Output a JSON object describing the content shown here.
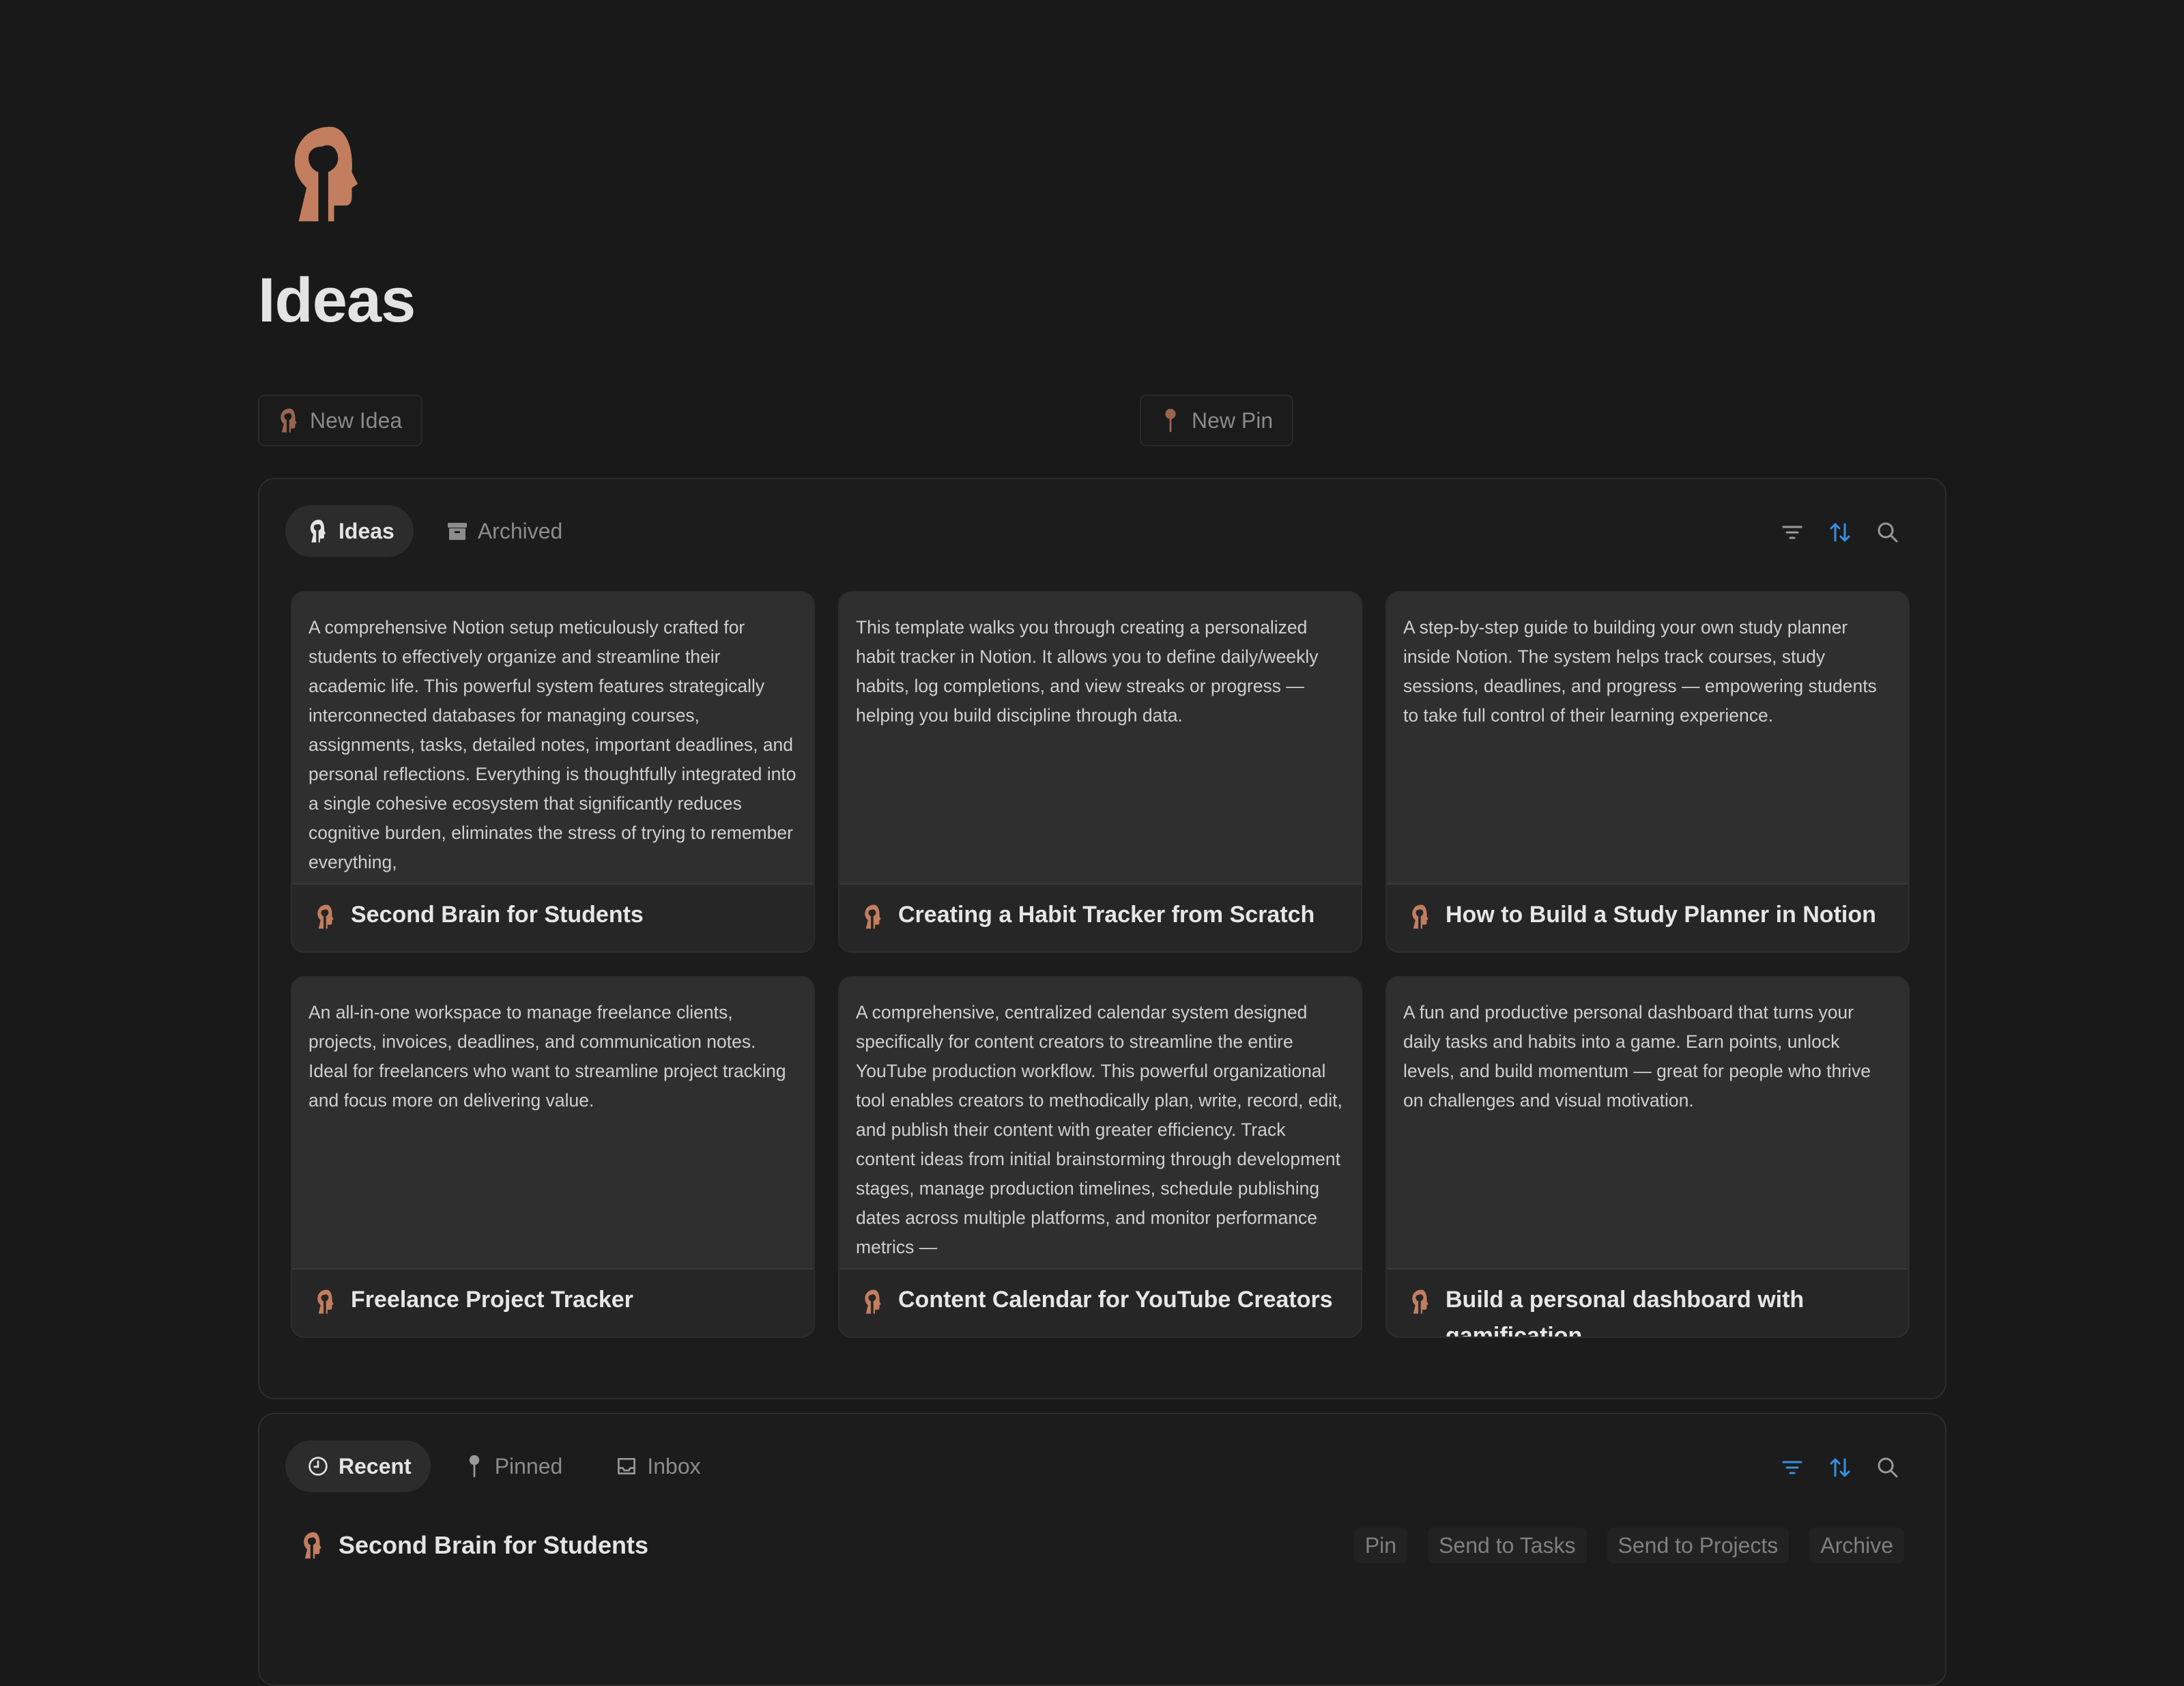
{
  "page": {
    "title": "Ideas",
    "icon": "head-silhouette-icon"
  },
  "actions": {
    "new_idea": "New Idea",
    "new_pin": "New Pin"
  },
  "ideas_panel": {
    "tabs": [
      {
        "label": "Ideas",
        "icon": "head-silhouette-icon",
        "active": true
      },
      {
        "label": "Archived",
        "icon": "archive-box-icon",
        "active": false
      }
    ],
    "tools": [
      "filter-icon",
      "sort-icon",
      "search-icon"
    ],
    "cards": [
      {
        "title": "Second Brain for Students",
        "description": "A comprehensive Notion setup meticulously crafted for students to effectively organize and streamline their academic life. This powerful system features strategically interconnected databases for managing courses, assignments, tasks, detailed notes, important deadlines, and personal reflections. Everything is thoughtfully integrated into a single cohesive ecosystem that significantly reduces cognitive burden, eliminates the stress of trying to remember everything,"
      },
      {
        "title": "Creating a Habit Tracker from Scratch",
        "description": "This template walks you through creating a personalized habit tracker in Notion. It allows you to define daily/weekly habits, log completions, and view streaks or progress — helping you build discipline through data."
      },
      {
        "title": "How to Build a Study Planner in Notion",
        "description": "A step-by-step guide to building your own study planner inside Notion. The system helps track courses, study sessions, deadlines, and progress — empowering students to take full control of their learning experience."
      },
      {
        "title": "Freelance Project Tracker",
        "description": "An all-in-one workspace to manage freelance clients, projects, invoices, deadlines, and communication notes. Ideal for freelancers who want to streamline project tracking and focus more on delivering value."
      },
      {
        "title": "Content Calendar for YouTube Creators",
        "description": "A comprehensive, centralized calendar system designed specifically for content creators to streamline the entire YouTube production workflow. This powerful organizational tool enables creators to methodically plan, write, record, edit, and publish their content with greater efficiency. Track content ideas from initial brainstorming through development stages, manage production timelines, schedule publishing dates across multiple platforms, and monitor performance metrics —"
      },
      {
        "title": "Build a personal dashboard with gamification",
        "description": "A fun and productive personal dashboard that turns your daily tasks and habits into a game. Earn points, unlock levels, and build momentum — great for people who thrive on challenges and visual motivation."
      }
    ]
  },
  "recent_panel": {
    "tabs": [
      {
        "label": "Recent",
        "icon": "clock-icon",
        "active": true
      },
      {
        "label": "Pinned",
        "icon": "pin-icon",
        "active": false
      },
      {
        "label": "Inbox",
        "icon": "inbox-tray-icon",
        "active": false
      }
    ],
    "tools": [
      "filter-icon",
      "sort-icon",
      "search-icon"
    ],
    "rows": [
      {
        "title": "Second Brain for Students",
        "actions": [
          "Pin",
          "Send to Tasks",
          "Send to Projects",
          "Archive"
        ]
      }
    ]
  },
  "colors": {
    "accent": "#c27e5f",
    "blue": "#3b8fe0",
    "background": "#191919"
  }
}
